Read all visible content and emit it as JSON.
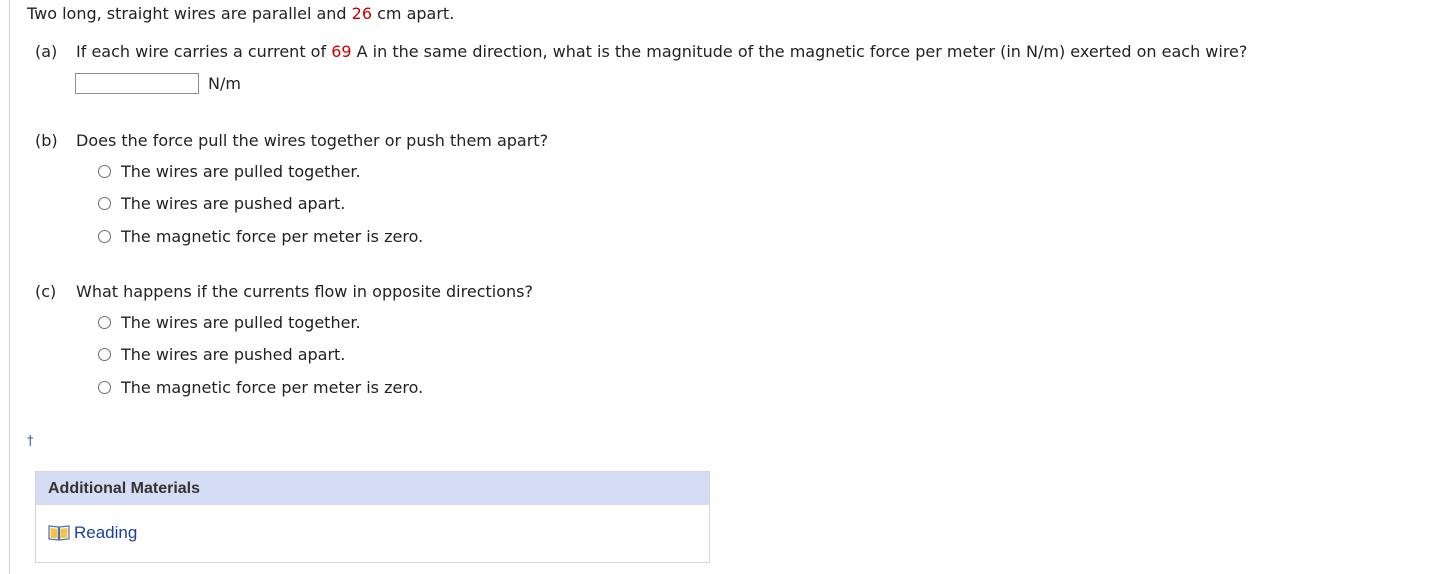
{
  "problem": {
    "intro_pre": "Two long, straight wires are parallel and ",
    "distance": "26",
    "intro_post": " cm apart."
  },
  "part_a": {
    "label": "(a)",
    "question_pre": "If each wire carries a current of ",
    "current": "69",
    "question_post": " A in the same direction, what is the magnitude of the magnetic force per meter (in N/m) exerted on each wire?",
    "input_value": "",
    "unit": "N/m"
  },
  "part_b": {
    "label": "(b)",
    "question": "Does the force pull the wires together or push them apart?",
    "options": [
      "The wires are pulled together.",
      "The wires are pushed apart.",
      "The magnetic force per meter is zero."
    ]
  },
  "part_c": {
    "label": "(c)",
    "question": "What happens if the currents flow in opposite directions?",
    "options": [
      "The wires are pulled together.",
      "The wires are pushed apart.",
      "The magnetic force per meter is zero."
    ]
  },
  "footnote_marker": "†",
  "additional_materials": {
    "title": "Additional Materials",
    "link_label": "Reading",
    "icon": "book-icon"
  },
  "colors": {
    "highlight_red": "#c80000",
    "materials_header_bg": "#d5ddf5",
    "link_blue": "#1b3fa0"
  }
}
